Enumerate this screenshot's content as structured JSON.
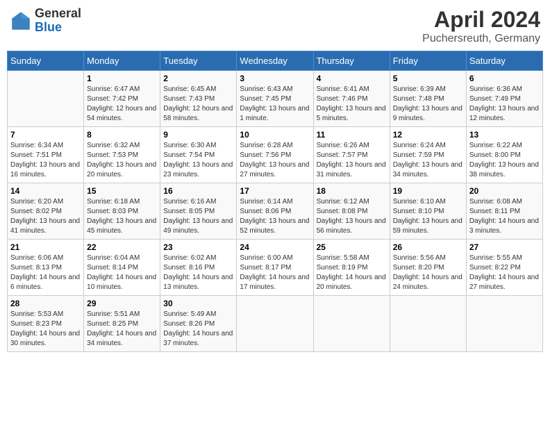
{
  "header": {
    "logo_general": "General",
    "logo_blue": "Blue",
    "title": "April 2024",
    "subtitle": "Puchersreuth, Germany"
  },
  "days_of_week": [
    "Sunday",
    "Monday",
    "Tuesday",
    "Wednesday",
    "Thursday",
    "Friday",
    "Saturday"
  ],
  "weeks": [
    [
      {
        "day": "",
        "info": ""
      },
      {
        "day": "1",
        "info": "Sunrise: 6:47 AM\nSunset: 7:42 PM\nDaylight: 12 hours\nand 54 minutes."
      },
      {
        "day": "2",
        "info": "Sunrise: 6:45 AM\nSunset: 7:43 PM\nDaylight: 12 hours\nand 58 minutes."
      },
      {
        "day": "3",
        "info": "Sunrise: 6:43 AM\nSunset: 7:45 PM\nDaylight: 13 hours\nand 1 minute."
      },
      {
        "day": "4",
        "info": "Sunrise: 6:41 AM\nSunset: 7:46 PM\nDaylight: 13 hours\nand 5 minutes."
      },
      {
        "day": "5",
        "info": "Sunrise: 6:39 AM\nSunset: 7:48 PM\nDaylight: 13 hours\nand 9 minutes."
      },
      {
        "day": "6",
        "info": "Sunrise: 6:36 AM\nSunset: 7:49 PM\nDaylight: 13 hours\nand 12 minutes."
      }
    ],
    [
      {
        "day": "7",
        "info": "Sunrise: 6:34 AM\nSunset: 7:51 PM\nDaylight: 13 hours\nand 16 minutes."
      },
      {
        "day": "8",
        "info": "Sunrise: 6:32 AM\nSunset: 7:53 PM\nDaylight: 13 hours\nand 20 minutes."
      },
      {
        "day": "9",
        "info": "Sunrise: 6:30 AM\nSunset: 7:54 PM\nDaylight: 13 hours\nand 23 minutes."
      },
      {
        "day": "10",
        "info": "Sunrise: 6:28 AM\nSunset: 7:56 PM\nDaylight: 13 hours\nand 27 minutes."
      },
      {
        "day": "11",
        "info": "Sunrise: 6:26 AM\nSunset: 7:57 PM\nDaylight: 13 hours\nand 31 minutes."
      },
      {
        "day": "12",
        "info": "Sunrise: 6:24 AM\nSunset: 7:59 PM\nDaylight: 13 hours\nand 34 minutes."
      },
      {
        "day": "13",
        "info": "Sunrise: 6:22 AM\nSunset: 8:00 PM\nDaylight: 13 hours\nand 38 minutes."
      }
    ],
    [
      {
        "day": "14",
        "info": "Sunrise: 6:20 AM\nSunset: 8:02 PM\nDaylight: 13 hours\nand 41 minutes."
      },
      {
        "day": "15",
        "info": "Sunrise: 6:18 AM\nSunset: 8:03 PM\nDaylight: 13 hours\nand 45 minutes."
      },
      {
        "day": "16",
        "info": "Sunrise: 6:16 AM\nSunset: 8:05 PM\nDaylight: 13 hours\nand 49 minutes."
      },
      {
        "day": "17",
        "info": "Sunrise: 6:14 AM\nSunset: 8:06 PM\nDaylight: 13 hours\nand 52 minutes."
      },
      {
        "day": "18",
        "info": "Sunrise: 6:12 AM\nSunset: 8:08 PM\nDaylight: 13 hours\nand 56 minutes."
      },
      {
        "day": "19",
        "info": "Sunrise: 6:10 AM\nSunset: 8:10 PM\nDaylight: 13 hours\nand 59 minutes."
      },
      {
        "day": "20",
        "info": "Sunrise: 6:08 AM\nSunset: 8:11 PM\nDaylight: 14 hours\nand 3 minutes."
      }
    ],
    [
      {
        "day": "21",
        "info": "Sunrise: 6:06 AM\nSunset: 8:13 PM\nDaylight: 14 hours\nand 6 minutes."
      },
      {
        "day": "22",
        "info": "Sunrise: 6:04 AM\nSunset: 8:14 PM\nDaylight: 14 hours\nand 10 minutes."
      },
      {
        "day": "23",
        "info": "Sunrise: 6:02 AM\nSunset: 8:16 PM\nDaylight: 14 hours\nand 13 minutes."
      },
      {
        "day": "24",
        "info": "Sunrise: 6:00 AM\nSunset: 8:17 PM\nDaylight: 14 hours\nand 17 minutes."
      },
      {
        "day": "25",
        "info": "Sunrise: 5:58 AM\nSunset: 8:19 PM\nDaylight: 14 hours\nand 20 minutes."
      },
      {
        "day": "26",
        "info": "Sunrise: 5:56 AM\nSunset: 8:20 PM\nDaylight: 14 hours\nand 24 minutes."
      },
      {
        "day": "27",
        "info": "Sunrise: 5:55 AM\nSunset: 8:22 PM\nDaylight: 14 hours\nand 27 minutes."
      }
    ],
    [
      {
        "day": "28",
        "info": "Sunrise: 5:53 AM\nSunset: 8:23 PM\nDaylight: 14 hours\nand 30 minutes."
      },
      {
        "day": "29",
        "info": "Sunrise: 5:51 AM\nSunset: 8:25 PM\nDaylight: 14 hours\nand 34 minutes."
      },
      {
        "day": "30",
        "info": "Sunrise: 5:49 AM\nSunset: 8:26 PM\nDaylight: 14 hours\nand 37 minutes."
      },
      {
        "day": "",
        "info": ""
      },
      {
        "day": "",
        "info": ""
      },
      {
        "day": "",
        "info": ""
      },
      {
        "day": "",
        "info": ""
      }
    ]
  ]
}
